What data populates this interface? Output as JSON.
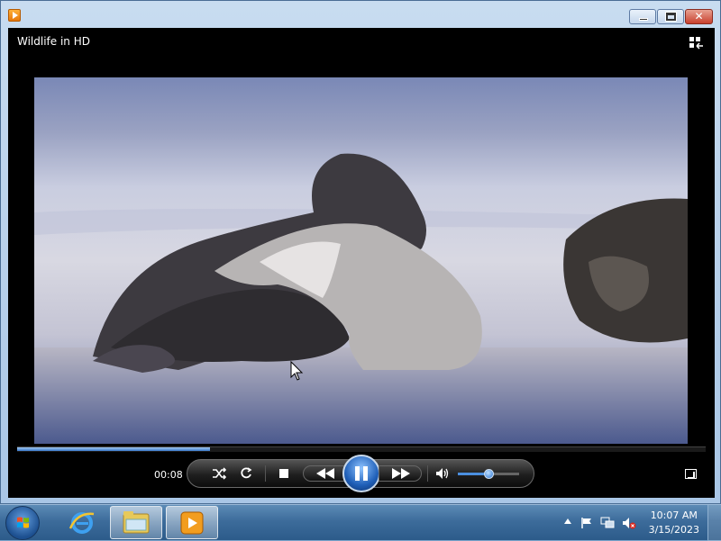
{
  "video": {
    "title": "Wildlife in HD",
    "elapsed": "00:08",
    "progress": 0.28,
    "volume": 0.5
  },
  "controls": {
    "icons": [
      "shuffle-icon",
      "repeat-icon",
      "stop-icon",
      "previous-icon",
      "pause-icon",
      "next-icon",
      "volume-icon",
      "fullscreen-icon",
      "switch-to-library-icon"
    ]
  },
  "taskbar": {
    "pinned": [
      "internet-explorer-icon",
      "windows-explorer-icon",
      "windows-media-player-icon"
    ]
  },
  "clock": {
    "time": "10:07 AM",
    "date": "3/15/2023"
  }
}
